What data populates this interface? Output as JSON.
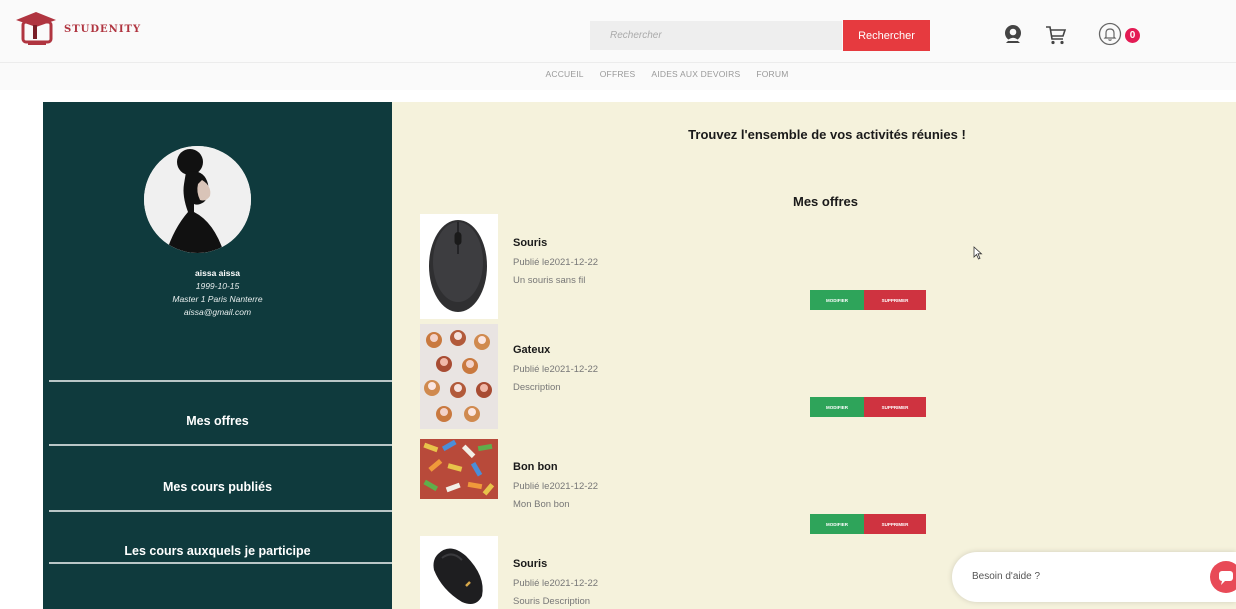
{
  "header": {
    "logo_text": "STUDENITY",
    "search_placeholder": "Rechercher",
    "search_button": "Rechercher",
    "notification_count": "0",
    "colors": {
      "brand": "#b03540",
      "accent": "#e63a3f",
      "badge": "#e31b54"
    },
    "icons": [
      "graduation-cap-logo-icon",
      "user-icon",
      "cart-icon",
      "bell-icon"
    ]
  },
  "nav": {
    "items": [
      "ACCUEIL",
      "OFFRES",
      "AIDES AUX DEVOIRS",
      "FORUM"
    ]
  },
  "profile": {
    "name": "aissa aissa",
    "birthdate": "1999-10-15",
    "school": "Master 1 Paris Nanterre",
    "email": "aissa@gmail.com"
  },
  "sidebar": {
    "items": [
      "Mes offres",
      "Mes cours publiés",
      "Les cours auxquels je participe"
    ],
    "colors": {
      "background": "#0f3a3d"
    }
  },
  "main": {
    "title": "Trouvez l'ensemble de vos activités réunies !",
    "offers_title": "Mes offres",
    "colors": {
      "background": "#f5f2dc"
    },
    "offers": [
      {
        "name": "Souris",
        "date": "Publié le2021-12-22",
        "description": "Un souris sans fil",
        "modify": "MODIFIER",
        "delete": "SUPPRIMER",
        "image": "mouse-icon"
      },
      {
        "name": "Gateux",
        "date": "Publié le2021-12-22",
        "description": "Description",
        "modify": "MODIFIER",
        "delete": "SUPPRIMER",
        "image": "cupcakes-icon"
      },
      {
        "name": "Bon bon",
        "date": "Publié le2021-12-22",
        "description": "Mon Bon bon",
        "modify": "MODIFIER",
        "delete": "SUPPRIMER",
        "image": "candies-icon"
      },
      {
        "name": "Souris",
        "date": "Publié le2021-12-22",
        "description": "Souris Description",
        "image": "gaming-mouse-icon"
      }
    ]
  },
  "chat": {
    "label": "Besoin d'aide ?"
  }
}
